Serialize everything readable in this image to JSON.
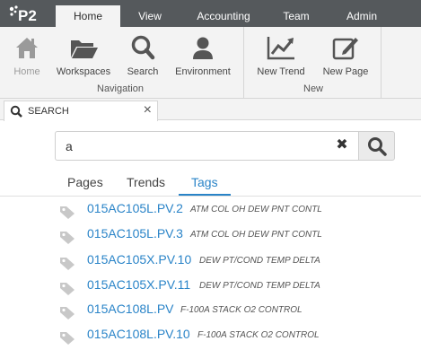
{
  "app": {
    "logo": "P2"
  },
  "menu": {
    "tabs": [
      {
        "label": "Home",
        "active": true
      },
      {
        "label": "View",
        "active": false
      },
      {
        "label": "Accounting",
        "active": false
      },
      {
        "label": "Team",
        "active": false
      },
      {
        "label": "Admin",
        "active": false
      }
    ]
  },
  "ribbon": {
    "navigation": {
      "group_label": "Navigation",
      "buttons": [
        {
          "label": "Home",
          "icon": "home-icon",
          "enabled": false
        },
        {
          "label": "Workspaces",
          "icon": "folder-icon",
          "enabled": true
        },
        {
          "label": "Search",
          "icon": "search-icon",
          "enabled": true
        },
        {
          "label": "Environment",
          "icon": "user-icon",
          "enabled": true
        }
      ]
    },
    "new": {
      "group_label": "New",
      "buttons": [
        {
          "label": "New Trend",
          "icon": "trend-chart-icon",
          "enabled": true
        },
        {
          "label": "New Page",
          "icon": "edit-page-icon",
          "enabled": true
        }
      ]
    }
  },
  "doc_tab": {
    "title": "SEARCH",
    "close": "×"
  },
  "search": {
    "value": "a",
    "clear": "✖"
  },
  "result_tabs": [
    {
      "label": "Pages",
      "active": false
    },
    {
      "label": "Trends",
      "active": false
    },
    {
      "label": "Tags",
      "active": true
    }
  ],
  "results": [
    {
      "name": "015AC105L.PV.2",
      "description": "ATM COL OH DEW PNT CONTL"
    },
    {
      "name": "015AC105L.PV.3",
      "description": "ATM COL OH DEW PNT CONTL"
    },
    {
      "name": "015AC105X.PV.10",
      "description": "DEW PT/COND TEMP DELTA"
    },
    {
      "name": "015AC105X.PV.11",
      "description": "DEW PT/COND TEMP DELTA"
    },
    {
      "name": "015AC108L.PV",
      "description": "F-100A STACK O2 CONTROL"
    },
    {
      "name": "015AC108L.PV.10",
      "description": "F-100A STACK O2 CONTROL"
    }
  ],
  "colors": {
    "accent": "#2a84c8",
    "menubar": "#55595c",
    "ribbon": "#f3f3f3"
  }
}
